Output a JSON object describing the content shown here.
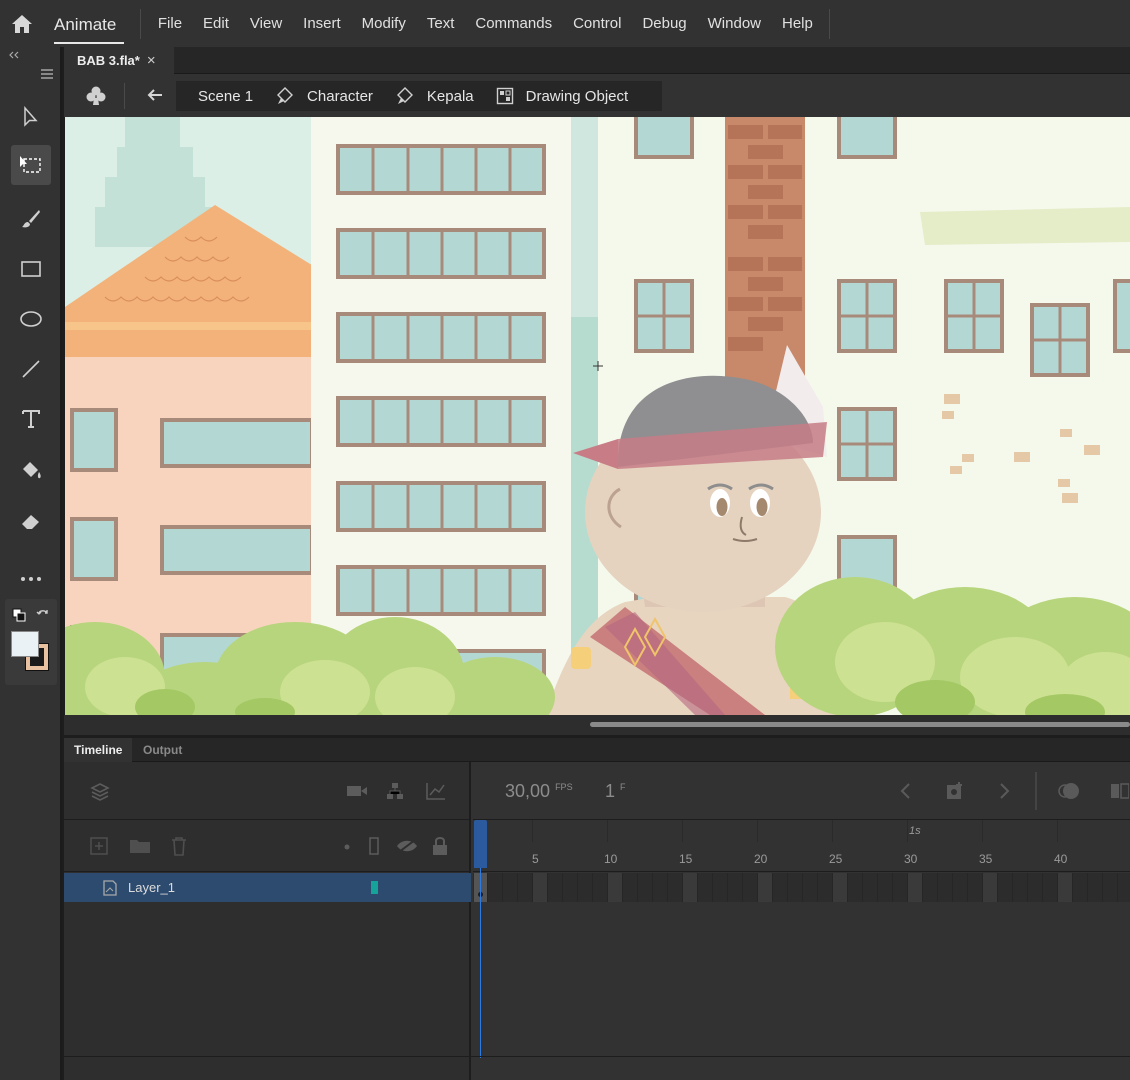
{
  "app": {
    "name": "Animate",
    "home_icon": "home-icon"
  },
  "menu": [
    "File",
    "Edit",
    "View",
    "Insert",
    "Modify",
    "Text",
    "Commands",
    "Control",
    "Debug",
    "Window",
    "Help"
  ],
  "document": {
    "tab_title": "BAB 3.fla*",
    "close_symbol": "×"
  },
  "breadcrumbs": [
    "Scene 1",
    "Character",
    "Kepala",
    "Drawing Object"
  ],
  "panel_tabs": {
    "timeline": "Timeline",
    "output": "Output"
  },
  "timeline": {
    "fps_value": "30,00",
    "fps_unit": "FPS",
    "current_frame": "1",
    "frame_unit": "F",
    "second_marker": "1s",
    "ruler_numbers": [
      "5",
      "10",
      "15",
      "20",
      "25",
      "30",
      "35",
      "40"
    ],
    "layers": [
      {
        "name": "Layer_1",
        "color": "#15a39a"
      }
    ]
  },
  "colors": {
    "stroke": "#e8c2a0",
    "fill": "#eaf2f6",
    "accent": "#2c4b6f"
  }
}
